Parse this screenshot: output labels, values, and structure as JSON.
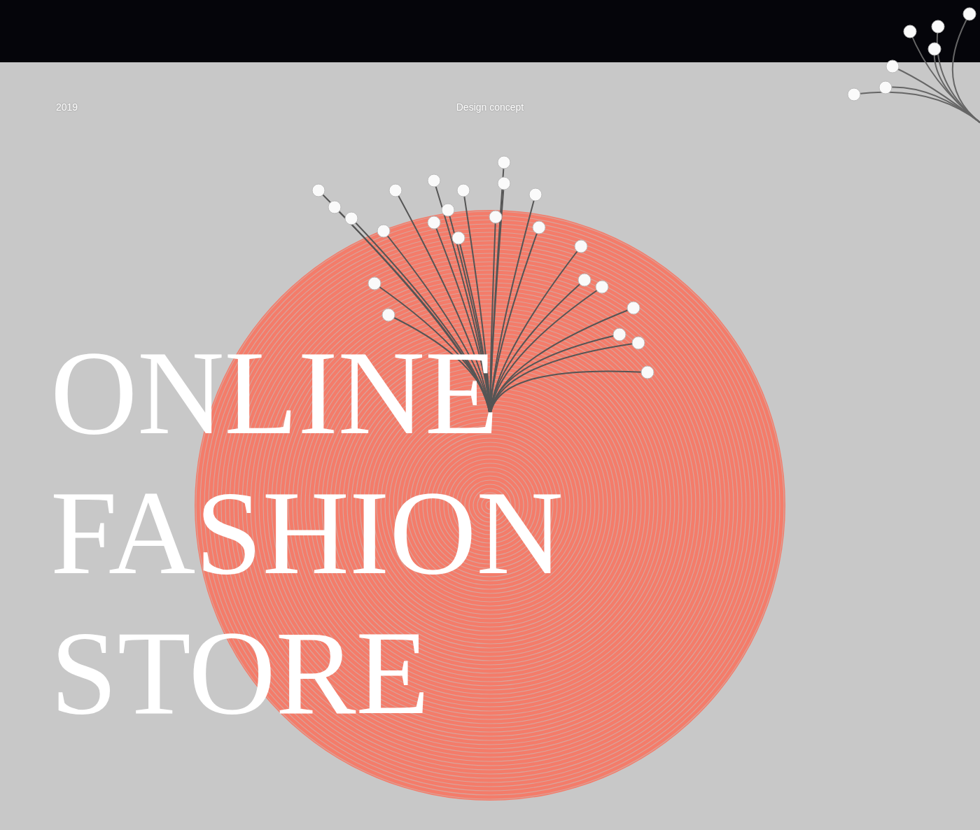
{
  "header": {
    "year": "2019",
    "label": "Design concept"
  },
  "hero": {
    "title_lines": [
      "ONLINE",
      "FASHION",
      "STORE"
    ]
  }
}
